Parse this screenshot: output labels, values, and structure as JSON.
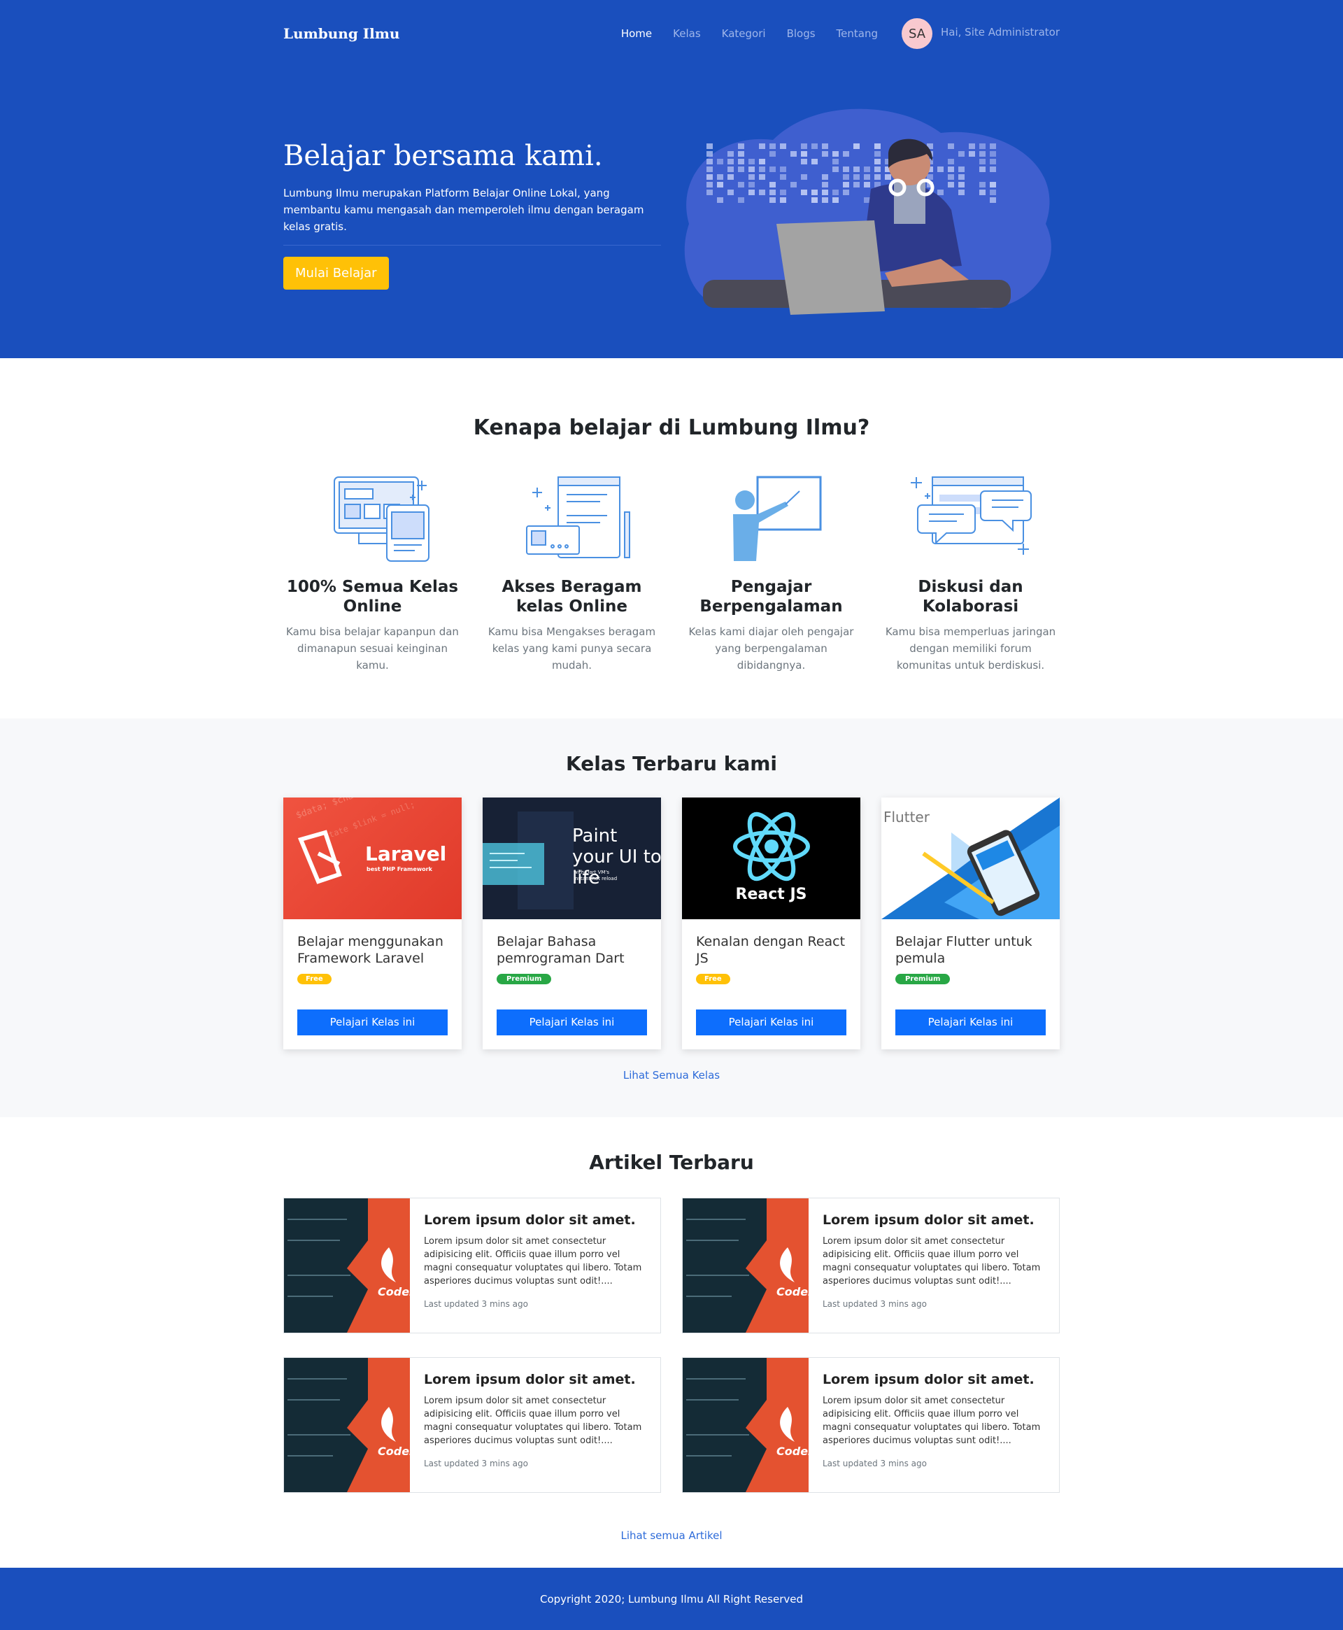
{
  "nav": {
    "brand": "Lumbung Ilmu",
    "links": [
      "Home",
      "Kelas",
      "Kategori",
      "Blogs",
      "Tentang"
    ],
    "avatar_initials": "SA",
    "greeting": "Hai, Site Administrator"
  },
  "hero": {
    "title": "Belajar bersama kami.",
    "description": "Lumbung Ilmu merupakan Platform Belajar Online Lokal, yang membantu kamu mengasah dan memperoleh ilmu dengan beragam kelas gratis.",
    "button": "Mulai Belajar"
  },
  "why": {
    "title": "Kenapa belajar di Lumbung Ilmu?",
    "features": [
      {
        "icon": "devices-icon",
        "title": "100% Semua Kelas Online",
        "desc": "Kamu bisa belajar kapanpun dan dimanapun sesuai keinginan kamu."
      },
      {
        "icon": "documents-icon",
        "title": "Akses Beragam kelas Online",
        "desc": "Kamu bisa Mengakses beragam kelas yang kami punya secara mudah."
      },
      {
        "icon": "teacher-icon",
        "title": "Pengajar Berpengalaman",
        "desc": "Kelas kami diajar oleh pengajar yang berpengalaman dibidangnya."
      },
      {
        "icon": "chat-icon",
        "title": "Diskusi dan Kolaborasi",
        "desc": "Kamu bisa memperluas jaringan dengan memiliki forum komunitas untuk berdiskusi."
      }
    ]
  },
  "kelas": {
    "title": "Kelas Terbaru kami",
    "cards": [
      {
        "title": "Belajar menggunakan Framework Laravel",
        "badge": "Free",
        "button": "Pelajari Kelas ini",
        "img_title": "Laravel",
        "img_sub": "best PHP Framework"
      },
      {
        "title": "Belajar Bahasa pemrograman Dart",
        "badge": "Premium",
        "button": "Pelajari Kelas ini",
        "img_title": "Paint your UI to life",
        "img_sub": "with Dart VM's instant hot reload"
      },
      {
        "title": "Kenalan dengan React JS",
        "badge": "Free",
        "button": "Pelajari Kelas ini",
        "img_title": "React JS"
      },
      {
        "title": "Belajar Flutter untuk pemula",
        "badge": "Premium",
        "button": "Pelajari Kelas ini",
        "img_title": "Flutter"
      }
    ],
    "more": "Lihat Semua Kelas"
  },
  "artikel": {
    "title": "Artikel Terbaru",
    "items": [
      {
        "title": "Lorem ipsum dolor sit amet.",
        "text": "Lorem ipsum dolor sit amet consectetur adipisicing elit. Officiis quae illum porro vel magni consequatur voluptates qui libero. Totam asperiores ducimus voluptas sunt odit!....",
        "meta": "Last updated 3 mins ago",
        "img_label": "CodeI"
      },
      {
        "title": "Lorem ipsum dolor sit amet.",
        "text": "Lorem ipsum dolor sit amet consectetur adipisicing elit. Officiis quae illum porro vel magni consequatur voluptates qui libero. Totam asperiores ducimus voluptas sunt odit!....",
        "meta": "Last updated 3 mins ago",
        "img_label": "CodeI"
      },
      {
        "title": "Lorem ipsum dolor sit amet.",
        "text": "Lorem ipsum dolor sit amet consectetur adipisicing elit. Officiis quae illum porro vel magni consequatur voluptates qui libero. Totam asperiores ducimus voluptas sunt odit!....",
        "meta": "Last updated 3 mins ago",
        "img_label": "CodeI"
      },
      {
        "title": "Lorem ipsum dolor sit amet.",
        "text": "Lorem ipsum dolor sit amet consectetur adipisicing elit. Officiis quae illum porro vel magni consequatur voluptates qui libero. Totam asperiores ducimus voluptas sunt odit!....",
        "meta": "Last updated 3 mins ago",
        "img_label": "CodeI"
      }
    ],
    "more": "Lihat semua Artikel"
  },
  "footer": {
    "text": "Copyright 2020; Lumbung Ilmu All Right Reserved"
  },
  "colors": {
    "primary_blue": "#1a4fbd",
    "accent_yellow": "#ffc107",
    "button_blue": "#0d6efd",
    "premium_green": "#28a745"
  }
}
